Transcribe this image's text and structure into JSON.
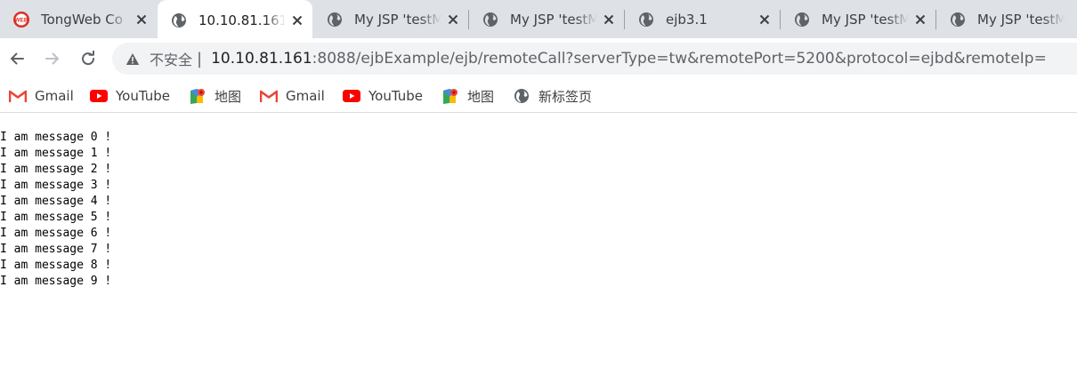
{
  "tabs": [
    {
      "title": "TongWeb Co",
      "icon": "tongweb-logo-icon",
      "active": false
    },
    {
      "title": "10.10.81.161:",
      "icon": "globe-icon",
      "active": true
    },
    {
      "title": "My JSP 'testM",
      "icon": "globe-icon",
      "active": false
    },
    {
      "title": "My JSP 'testM",
      "icon": "globe-icon",
      "active": false
    },
    {
      "title": "ejb3.1",
      "icon": "globe-icon",
      "active": false
    },
    {
      "title": "My JSP 'testM",
      "icon": "globe-icon",
      "active": false
    },
    {
      "title": "My JSP 'testM",
      "icon": "globe-icon",
      "active": false
    }
  ],
  "tongweb_logo_text": "WEB",
  "omnibox": {
    "security_label": "不安全",
    "divider": "|",
    "url_host": "10.10.81.161",
    "url_rest": ":8088/ejbExample/ejb/remoteCall?serverType=tw&remotePort=5200&protocol=ejbd&remoteIp="
  },
  "bookmarks": [
    {
      "label": "Gmail",
      "icon": "gmail-icon"
    },
    {
      "label": "YouTube",
      "icon": "youtube-icon"
    },
    {
      "label": "地图",
      "icon": "maps-icon"
    },
    {
      "label": "Gmail",
      "icon": "gmail-icon"
    },
    {
      "label": "YouTube",
      "icon": "youtube-icon"
    },
    {
      "label": "地图",
      "icon": "maps-icon"
    },
    {
      "label": "新标签页",
      "icon": "globe-icon"
    }
  ],
  "messages": [
    "I am message 0 !",
    "I am message 1 !",
    "I am message 2 !",
    "I am message 3 !",
    "I am message 4 !",
    "I am message 5 !",
    "I am message 6 !",
    "I am message 7 !",
    "I am message 8 !",
    "I am message 9 !"
  ],
  "colors": {
    "tabstrip_bg": "#dee1e6",
    "omnibox_bg": "#f1f3f4",
    "gmail_red": "#ea4335",
    "youtube_red": "#ff0000",
    "icon_gray": "#5f6368"
  }
}
